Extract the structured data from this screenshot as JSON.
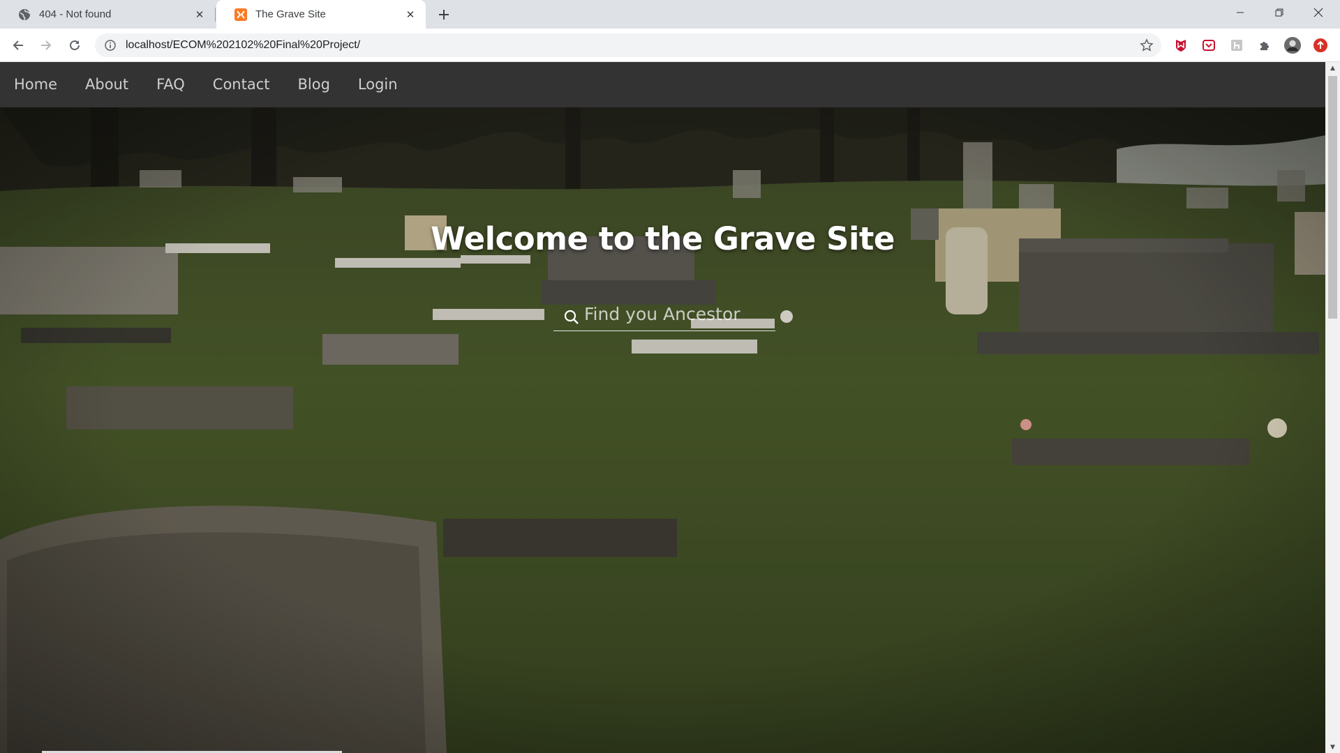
{
  "browser": {
    "tabs": [
      {
        "title": "404 - Not found",
        "active": false,
        "favicon": "globe-icon"
      },
      {
        "title": "The Grave Site",
        "active": true,
        "favicon": "xampp-icon"
      }
    ],
    "address": "localhost/ECOM%202102%20Final%20Project/",
    "colors": {
      "tabstrip": "#dee1e6",
      "omnibox": "#f1f3f4"
    }
  },
  "site": {
    "nav": [
      "Home",
      "About",
      "FAQ",
      "Contact",
      "Blog",
      "Login"
    ],
    "hero": {
      "title": "Welcome to the Grave Site",
      "search_placeholder": "Find you Ancestor"
    },
    "colors": {
      "navbar": "#333333",
      "nav_text": "#cfcfcf",
      "grass": "#4a5a2c"
    }
  }
}
